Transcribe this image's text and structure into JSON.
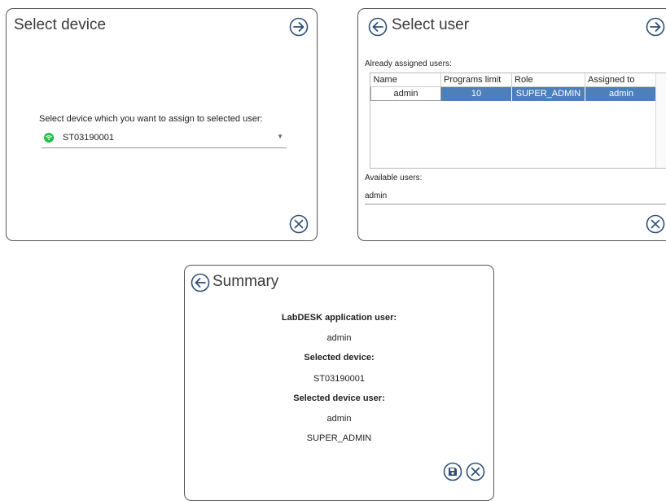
{
  "select_device": {
    "title": "Select device",
    "prompt": "Select device which you want to assign to selected user:",
    "device_value": "ST03190001"
  },
  "select_user": {
    "title": "Select user",
    "assigned_label": "Already assigned users:",
    "columns": [
      "Name",
      "Programs limit",
      "Role",
      "Assigned to"
    ],
    "rows": [
      {
        "name": "admin",
        "programs_limit": "10",
        "role": "SUPER_ADMIN",
        "assigned_to": "admin"
      }
    ],
    "available_label": "Available users:",
    "available_value": "admin"
  },
  "summary": {
    "title": "Summary",
    "app_user_label": "LabDESK application user:",
    "app_user_value": "admin",
    "device_label": "Selected device:",
    "device_value": "ST03190001",
    "device_user_label": "Selected device user:",
    "device_user_value": "admin",
    "device_user_role": "SUPER_ADMIN"
  },
  "colors": {
    "selected_row": "#4d7fba",
    "wifi_ok": "#22c04a",
    "icon_stroke": "#2f4f7a"
  },
  "icons": [
    "arrow-right-circle",
    "arrow-left-circle",
    "close-circle",
    "save-circle",
    "wifi"
  ]
}
